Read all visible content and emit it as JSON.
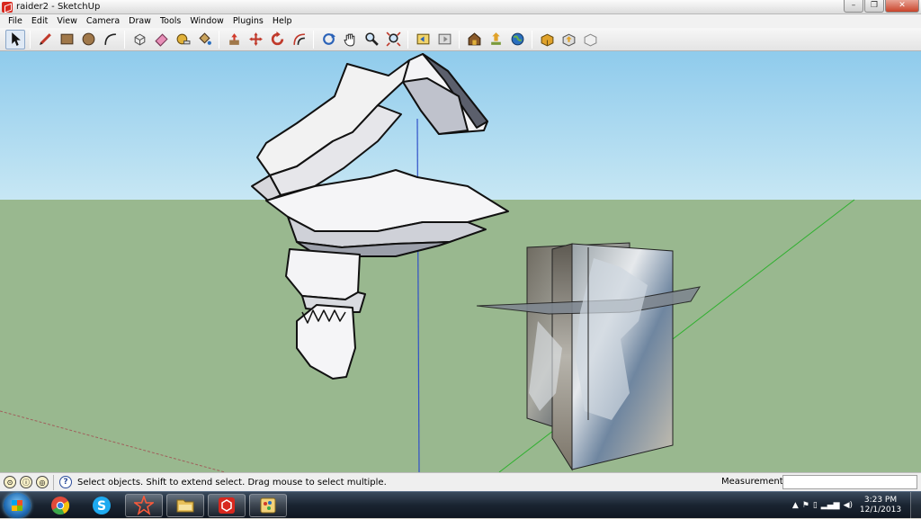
{
  "window": {
    "title": "raider2 - SketchUp",
    "minimize": "–",
    "maximize": "❐",
    "close": "✕"
  },
  "menu": [
    "File",
    "Edit",
    "View",
    "Camera",
    "Draw",
    "Tools",
    "Window",
    "Plugins",
    "Help"
  ],
  "toolbar": {
    "tools": [
      {
        "name": "select-tool",
        "icon": "arrow-icon",
        "active": true
      },
      {
        "name": "pencil-tool",
        "icon": "pencil-icon"
      },
      {
        "name": "rectangle-tool",
        "icon": "rectangle-icon"
      },
      {
        "name": "circle-tool",
        "icon": "circle-icon"
      },
      {
        "name": "arc-tool",
        "icon": "arc-icon"
      },
      {
        "name": "make-component-tool",
        "icon": "component-icon"
      },
      {
        "name": "eraser-tool",
        "icon": "eraser-icon"
      },
      {
        "name": "tape-measure-tool",
        "icon": "tape-icon"
      },
      {
        "name": "paint-bucket-tool",
        "icon": "paint-bucket-icon"
      },
      {
        "name": "push-pull-tool",
        "icon": "push-pull-icon"
      },
      {
        "name": "move-tool",
        "icon": "move-icon"
      },
      {
        "name": "rotate-tool",
        "icon": "rotate-icon"
      },
      {
        "name": "offset-tool",
        "icon": "offset-icon"
      },
      {
        "name": "orbit-tool",
        "icon": "orbit-icon"
      },
      {
        "name": "pan-tool",
        "icon": "hand-icon"
      },
      {
        "name": "zoom-tool",
        "icon": "magnifier-icon"
      },
      {
        "name": "zoom-extents-tool",
        "icon": "zoom-extents-icon"
      },
      {
        "name": "previous-view-tool",
        "icon": "previous-icon"
      },
      {
        "name": "next-view-tool",
        "icon": "next-icon"
      },
      {
        "name": "get-models-tool",
        "icon": "warehouse-icon"
      },
      {
        "name": "share-model-tool",
        "icon": "share-icon"
      },
      {
        "name": "google-earth-tool",
        "icon": "globe-icon"
      },
      {
        "name": "get-components-tool",
        "icon": "get-components-icon"
      },
      {
        "name": "share-component-tool",
        "icon": "share-component-icon"
      },
      {
        "name": "extension-tool",
        "icon": "extension-icon"
      }
    ]
  },
  "status": {
    "message": "Select objects. Shift to extend select. Drag mouse to select multiple.",
    "measurements_label": "Measurements",
    "measurements_value": ""
  },
  "taskbar": {
    "apps": [
      {
        "name": "chrome-app",
        "icon": "chrome-icon",
        "state": "pinned"
      },
      {
        "name": "skype-app",
        "icon": "skype-icon",
        "state": "pinned"
      },
      {
        "name": "3d-app",
        "icon": "star-icon",
        "state": "running"
      },
      {
        "name": "explorer-app",
        "icon": "folder-icon",
        "state": "running"
      },
      {
        "name": "sketchup-app",
        "icon": "sketchup-icon",
        "state": "running"
      },
      {
        "name": "paint-app",
        "icon": "paint-icon",
        "state": "running"
      }
    ],
    "time": "3:23 PM",
    "date": "12/1/2013"
  },
  "colors": {
    "sky": "#a9d8ef",
    "ground": "#99b88f",
    "accent": "#d8281e"
  }
}
